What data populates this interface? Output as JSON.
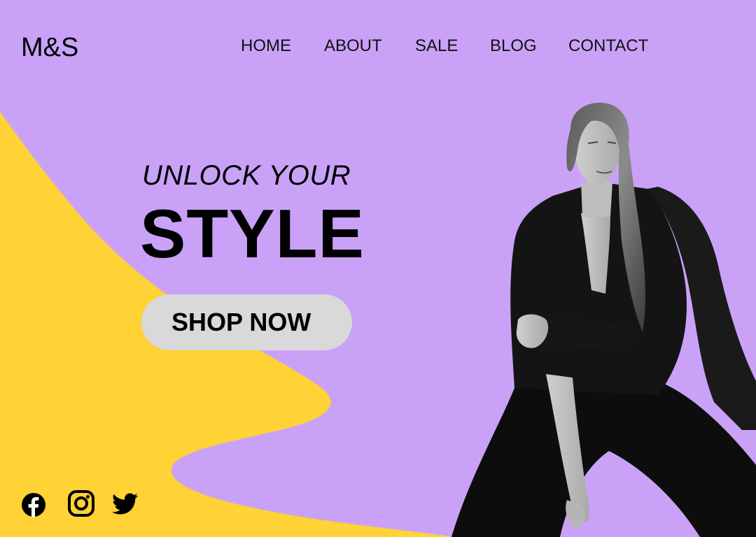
{
  "brand": {
    "logo_text": "M&S"
  },
  "nav": {
    "items": [
      {
        "label": "HOME"
      },
      {
        "label": "ABOUT"
      },
      {
        "label": "SALE"
      },
      {
        "label": "BLOG"
      },
      {
        "label": "CONTACT"
      }
    ]
  },
  "hero": {
    "subtitle": "UNLOCK YOUR",
    "title": "STYLE",
    "cta_label": "SHOP NOW"
  },
  "social": {
    "icons": [
      "facebook-icon",
      "instagram-icon",
      "twitter-icon"
    ]
  },
  "colors": {
    "background": "#c9a2f8",
    "accent_blob": "#ffd235",
    "button": "#d9d9d9",
    "text": "#000000"
  }
}
